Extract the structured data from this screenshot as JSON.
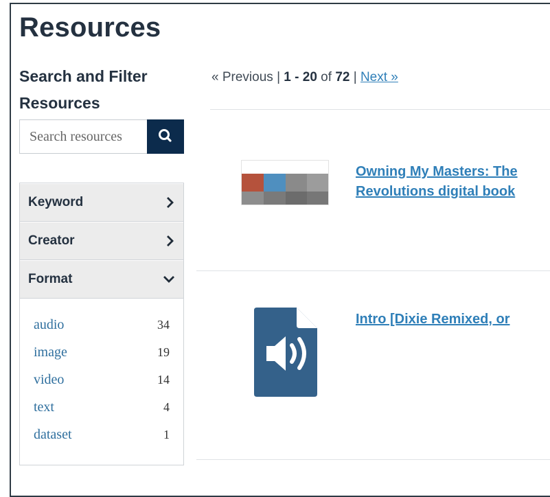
{
  "page": {
    "title": "Resources"
  },
  "sidebar": {
    "heading_line1": "Search and Filter",
    "heading_line2": "Resources",
    "search": {
      "placeholder": "Search resources",
      "button_icon": "search-icon"
    },
    "facets": [
      {
        "label": "Keyword",
        "icon": "chevron-right-icon",
        "expanded": false
      },
      {
        "label": "Creator",
        "icon": "chevron-right-icon",
        "expanded": false
      },
      {
        "label": "Format",
        "icon": "chevron-down-icon",
        "expanded": true
      }
    ],
    "formats": [
      {
        "label": "audio",
        "count": "34"
      },
      {
        "label": "image",
        "count": "19"
      },
      {
        "label": "video",
        "count": "14"
      },
      {
        "label": "text",
        "count": "4"
      },
      {
        "label": "dataset",
        "count": "1"
      }
    ]
  },
  "pager": {
    "previous": "« Previous",
    "sep1": "|",
    "range_start": "1",
    "range_dash": "-",
    "range_end": "20",
    "of": "of",
    "total": "72",
    "sep2": "|",
    "next": "Next »"
  },
  "results": [
    {
      "title_line1": "Owning My Masters: The",
      "title_line2": "Revolutions digital book",
      "thumbnail": "book-cover-thumbnail"
    },
    {
      "title_line1": "Intro [Dixie Remixed, or",
      "thumbnail": "audio-file-icon"
    }
  ],
  "colors": {
    "accent": "#0c2b4c",
    "link": "#2f7fb8",
    "facet_link": "#2f6f9e",
    "audio_icon": "#34618a"
  }
}
